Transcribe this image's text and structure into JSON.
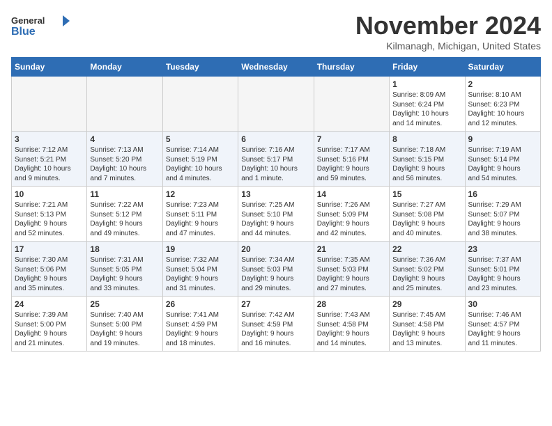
{
  "header": {
    "logo_general": "General",
    "logo_blue": "Blue",
    "month_title": "November 2024",
    "location": "Kilmanagh, Michigan, United States"
  },
  "days_of_week": [
    "Sunday",
    "Monday",
    "Tuesday",
    "Wednesday",
    "Thursday",
    "Friday",
    "Saturday"
  ],
  "weeks": [
    [
      {
        "day": "",
        "info": ""
      },
      {
        "day": "",
        "info": ""
      },
      {
        "day": "",
        "info": ""
      },
      {
        "day": "",
        "info": ""
      },
      {
        "day": "",
        "info": ""
      },
      {
        "day": "1",
        "info": "Sunrise: 8:09 AM\nSunset: 6:24 PM\nDaylight: 10 hours\nand 14 minutes."
      },
      {
        "day": "2",
        "info": "Sunrise: 8:10 AM\nSunset: 6:23 PM\nDaylight: 10 hours\nand 12 minutes."
      }
    ],
    [
      {
        "day": "3",
        "info": "Sunrise: 7:12 AM\nSunset: 5:21 PM\nDaylight: 10 hours\nand 9 minutes."
      },
      {
        "day": "4",
        "info": "Sunrise: 7:13 AM\nSunset: 5:20 PM\nDaylight: 10 hours\nand 7 minutes."
      },
      {
        "day": "5",
        "info": "Sunrise: 7:14 AM\nSunset: 5:19 PM\nDaylight: 10 hours\nand 4 minutes."
      },
      {
        "day": "6",
        "info": "Sunrise: 7:16 AM\nSunset: 5:17 PM\nDaylight: 10 hours\nand 1 minute."
      },
      {
        "day": "7",
        "info": "Sunrise: 7:17 AM\nSunset: 5:16 PM\nDaylight: 9 hours\nand 59 minutes."
      },
      {
        "day": "8",
        "info": "Sunrise: 7:18 AM\nSunset: 5:15 PM\nDaylight: 9 hours\nand 56 minutes."
      },
      {
        "day": "9",
        "info": "Sunrise: 7:19 AM\nSunset: 5:14 PM\nDaylight: 9 hours\nand 54 minutes."
      }
    ],
    [
      {
        "day": "10",
        "info": "Sunrise: 7:21 AM\nSunset: 5:13 PM\nDaylight: 9 hours\nand 52 minutes."
      },
      {
        "day": "11",
        "info": "Sunrise: 7:22 AM\nSunset: 5:12 PM\nDaylight: 9 hours\nand 49 minutes."
      },
      {
        "day": "12",
        "info": "Sunrise: 7:23 AM\nSunset: 5:11 PM\nDaylight: 9 hours\nand 47 minutes."
      },
      {
        "day": "13",
        "info": "Sunrise: 7:25 AM\nSunset: 5:10 PM\nDaylight: 9 hours\nand 44 minutes."
      },
      {
        "day": "14",
        "info": "Sunrise: 7:26 AM\nSunset: 5:09 PM\nDaylight: 9 hours\nand 42 minutes."
      },
      {
        "day": "15",
        "info": "Sunrise: 7:27 AM\nSunset: 5:08 PM\nDaylight: 9 hours\nand 40 minutes."
      },
      {
        "day": "16",
        "info": "Sunrise: 7:29 AM\nSunset: 5:07 PM\nDaylight: 9 hours\nand 38 minutes."
      }
    ],
    [
      {
        "day": "17",
        "info": "Sunrise: 7:30 AM\nSunset: 5:06 PM\nDaylight: 9 hours\nand 35 minutes."
      },
      {
        "day": "18",
        "info": "Sunrise: 7:31 AM\nSunset: 5:05 PM\nDaylight: 9 hours\nand 33 minutes."
      },
      {
        "day": "19",
        "info": "Sunrise: 7:32 AM\nSunset: 5:04 PM\nDaylight: 9 hours\nand 31 minutes."
      },
      {
        "day": "20",
        "info": "Sunrise: 7:34 AM\nSunset: 5:03 PM\nDaylight: 9 hours\nand 29 minutes."
      },
      {
        "day": "21",
        "info": "Sunrise: 7:35 AM\nSunset: 5:03 PM\nDaylight: 9 hours\nand 27 minutes."
      },
      {
        "day": "22",
        "info": "Sunrise: 7:36 AM\nSunset: 5:02 PM\nDaylight: 9 hours\nand 25 minutes."
      },
      {
        "day": "23",
        "info": "Sunrise: 7:37 AM\nSunset: 5:01 PM\nDaylight: 9 hours\nand 23 minutes."
      }
    ],
    [
      {
        "day": "24",
        "info": "Sunrise: 7:39 AM\nSunset: 5:00 PM\nDaylight: 9 hours\nand 21 minutes."
      },
      {
        "day": "25",
        "info": "Sunrise: 7:40 AM\nSunset: 5:00 PM\nDaylight: 9 hours\nand 19 minutes."
      },
      {
        "day": "26",
        "info": "Sunrise: 7:41 AM\nSunset: 4:59 PM\nDaylight: 9 hours\nand 18 minutes."
      },
      {
        "day": "27",
        "info": "Sunrise: 7:42 AM\nSunset: 4:59 PM\nDaylight: 9 hours\nand 16 minutes."
      },
      {
        "day": "28",
        "info": "Sunrise: 7:43 AM\nSunset: 4:58 PM\nDaylight: 9 hours\nand 14 minutes."
      },
      {
        "day": "29",
        "info": "Sunrise: 7:45 AM\nSunset: 4:58 PM\nDaylight: 9 hours\nand 13 minutes."
      },
      {
        "day": "30",
        "info": "Sunrise: 7:46 AM\nSunset: 4:57 PM\nDaylight: 9 hours\nand 11 minutes."
      }
    ]
  ]
}
